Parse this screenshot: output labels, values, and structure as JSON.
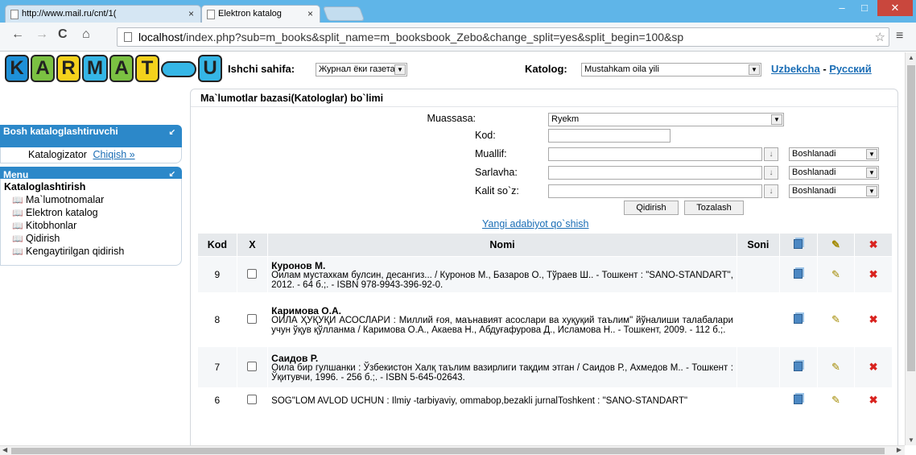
{
  "browser": {
    "tabs": [
      {
        "title": "http://www.mail.ru/cnt/1(",
        "close": "×"
      },
      {
        "title": "Elektron katalog",
        "close": "×"
      }
    ],
    "url_host": "localhost",
    "url_path": "/index.php?sub=m_books&split_name=m_booksbook_Zebo&change_split=yes&split_begin=100&sp",
    "window_controls": {
      "minimize": "–",
      "maximize": "□",
      "close": "✕"
    }
  },
  "header": {
    "logo_letters": [
      "K",
      "A",
      "R",
      "M",
      "A",
      "T",
      "",
      "U"
    ],
    "ishchi_label": "Ishchi sahifa:",
    "ishchi_value": "Журнал ёки газетани",
    "katolog_label": "Katolog:",
    "katolog_value": "Mustahkam oila yili",
    "lang_uz": "Uzbekcha",
    "lang_sep": " - ",
    "lang_ru": "Русский"
  },
  "sidebar": {
    "section1_title": "Bosh kataloglashtiruvchi",
    "user_role": "Katalogizator",
    "logout": "Chiqish »",
    "section2_title": "Menu",
    "menu_heading": "Kataloglashtirish",
    "items": [
      "Ma`lumotnomalar",
      "Elektron katalog",
      "Kitobhonlar",
      "Qidirish",
      "Kengaytirilgan qidirish"
    ]
  },
  "main": {
    "title": "Ma`lumotlar bazasi(Katologlar) bo`limi",
    "form": {
      "muassasa_label": "Muassasa:",
      "muassasa_value": "Ryekm",
      "kod_label": "Kod:",
      "muallif_label": "Muallif:",
      "sarlavha_label": "Sarlavha:",
      "kalit_label": "Kalit so`z:",
      "sort_symbol": "↓",
      "match_value": "Boshlanadi",
      "search_button": "Qidirish",
      "clear_button": "Tozalash"
    },
    "new_link": "Yangi adabiyot qo`shish",
    "table": {
      "headers": {
        "kod": "Kod",
        "x": "X",
        "nomi": "Nomi",
        "soni": "Soni"
      },
      "rows": [
        {
          "kod": "9",
          "author": "Куронов М.",
          "desc": "Оилам мустахкам булсин, десангиз... / Куронов М., Базаров О., Тўраев Ш.. - Тошкент : \"SANO-STANDART\", 2012. - 64 б.;. - ISBN 978-9943-396-92-0.",
          "soni": ""
        },
        {
          "kod": "8",
          "author": "Каримова О.А.",
          "desc": "ОИЛА ҲУҚУҚИ АСОСЛАРИ : Миллий ғоя, маънавият асослари ва хуқуқий таълим\" йўналиши талабалари учун ўқув қўлланма / Каримова О.А., Акаева Н., Абдуғафурова Д., Исламова Н.. - Тошкент, 2009. - 112 б.;.",
          "soni": ""
        },
        {
          "kod": "7",
          "author": "Саидов Р.",
          "desc": "Оила бир гулшанки : Ўзбекистон Халқ таълим вазирлиги тақдим этган / Саидов Р., Ахмедов М.. - Тошкент : Ўқитувчи, 1996. - 256 б.;. - ISBN 5-645-02643.",
          "soni": ""
        },
        {
          "kod": "6",
          "author": "",
          "desc": "SOG\"LOM AVLOD UCHUN : Ilmiy -tarbiyaviy, ommabop,bezakli jurnalToshkent : \"SANO-STANDART\"",
          "soni": ""
        }
      ]
    }
  },
  "colors": {
    "titlebar": "#5fb5e8",
    "sidebar_header": "#2c88c9",
    "link": "#1a6db5"
  }
}
